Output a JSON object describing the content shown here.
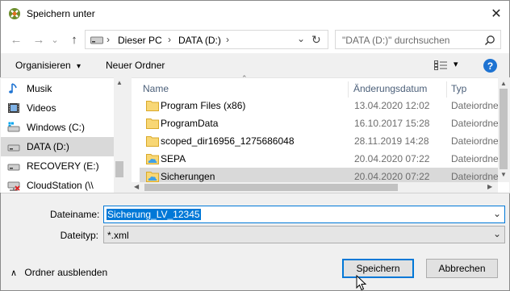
{
  "window": {
    "title": "Speichern unter",
    "close_symbol": "✕"
  },
  "nav": {
    "back_symbol": "←",
    "forward_symbol": "→",
    "recent_symbol": "⌄",
    "up_symbol": "↑",
    "breadcrumb": [
      "Dieser PC",
      "DATA (D:)"
    ],
    "breadcrumb_sep": "›",
    "dropdown_symbol": "⌄",
    "refresh_symbol": "↻",
    "search_placeholder": "\"DATA (D:)\" durchsuchen"
  },
  "toolbar": {
    "organize_label": "Organisieren",
    "new_folder_label": "Neuer Ordner",
    "view_dropdown_symbol": "▾",
    "help_symbol": "?"
  },
  "sidebar": {
    "items": [
      {
        "label": "Musik",
        "icon": "music-icon"
      },
      {
        "label": "Videos",
        "icon": "video-icon"
      },
      {
        "label": "Windows (C:)",
        "icon": "windows-drive-icon"
      },
      {
        "label": "DATA (D:)",
        "icon": "drive-icon",
        "selected": true
      },
      {
        "label": "RECOVERY (E:)",
        "icon": "drive-icon"
      },
      {
        "label": "CloudStation (\\\\",
        "icon": "network-drive-icon"
      }
    ]
  },
  "files": {
    "columns": {
      "name": "Name",
      "date": "Änderungsdatum",
      "type": "Typ"
    },
    "rows": [
      {
        "name": "Program Files (x86)",
        "date": "13.04.2020 12:02",
        "type": "Dateiordner",
        "icon": "folder-icon"
      },
      {
        "name": "ProgramData",
        "date": "16.10.2017 15:28",
        "type": "Dateiordner",
        "icon": "folder-icon"
      },
      {
        "name": "scoped_dir16956_1275686048",
        "date": "28.11.2019 14:28",
        "type": "Dateiordner",
        "icon": "folder-icon"
      },
      {
        "name": "SEPA",
        "date": "20.04.2020 07:22",
        "type": "Dateiordner",
        "icon": "cloud-folder-icon"
      },
      {
        "name": "Sicherungen",
        "date": "20.04.2020 07:22",
        "type": "Dateiordner",
        "icon": "cloud-folder-icon",
        "selected": true
      }
    ]
  },
  "form": {
    "filename_label": "Dateiname:",
    "filename_value": "Sicherung_LV_12345",
    "filetype_label": "Dateityp:",
    "filetype_value": "*.xml",
    "combo_arrow": "⌄"
  },
  "footer": {
    "hide_folders_symbol": "∧",
    "hide_folders_label": "Ordner ausblenden",
    "save_label": "Speichern",
    "cancel_label": "Abbrechen"
  },
  "colors": {
    "accent": "#0078d7",
    "folder": "#f8d775",
    "help": "#1e73d2"
  }
}
